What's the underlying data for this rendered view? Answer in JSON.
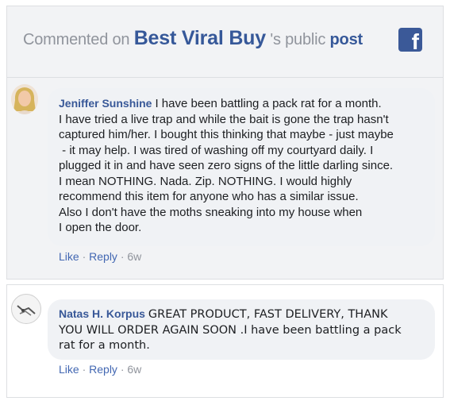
{
  "header": {
    "prefix": "Commented on",
    "page_name": "Best Viral Buy",
    "suffix": "'s public",
    "post_word": "post",
    "logo": "facebook-logo"
  },
  "comments": [
    {
      "author": "Jeniffer Sunshine",
      "lines": [
        "I have been battling a pack rat for a month.",
        "I have tried a live trap and while the bait is gone the trap hasn't",
        "captured him/her. I bought this thinking that maybe - just maybe",
        " - it may help. I was tired of washing off my courtyard daily. I",
        "plugged it in and have seen zero signs of the little darling since.",
        "I mean NOTHING. Nada. Zip. NOTHING. I would highly",
        "recommend this item for anyone who has a similar issue.",
        "Also I don't have the moths sneaking into my house when",
        "I open the door."
      ],
      "like": "Like",
      "reply": "Reply",
      "time": "6w"
    },
    {
      "author": "Natas H. Korpus",
      "lines": [
        "GREAT PRODUCT, FAST DELIVERY, THANK",
        "YOU WILL ORDER AGAIN SOON .I have been battling a pack",
        "rat for a month."
      ],
      "like": "Like",
      "reply": "Reply",
      "time": "6w"
    }
  ]
}
